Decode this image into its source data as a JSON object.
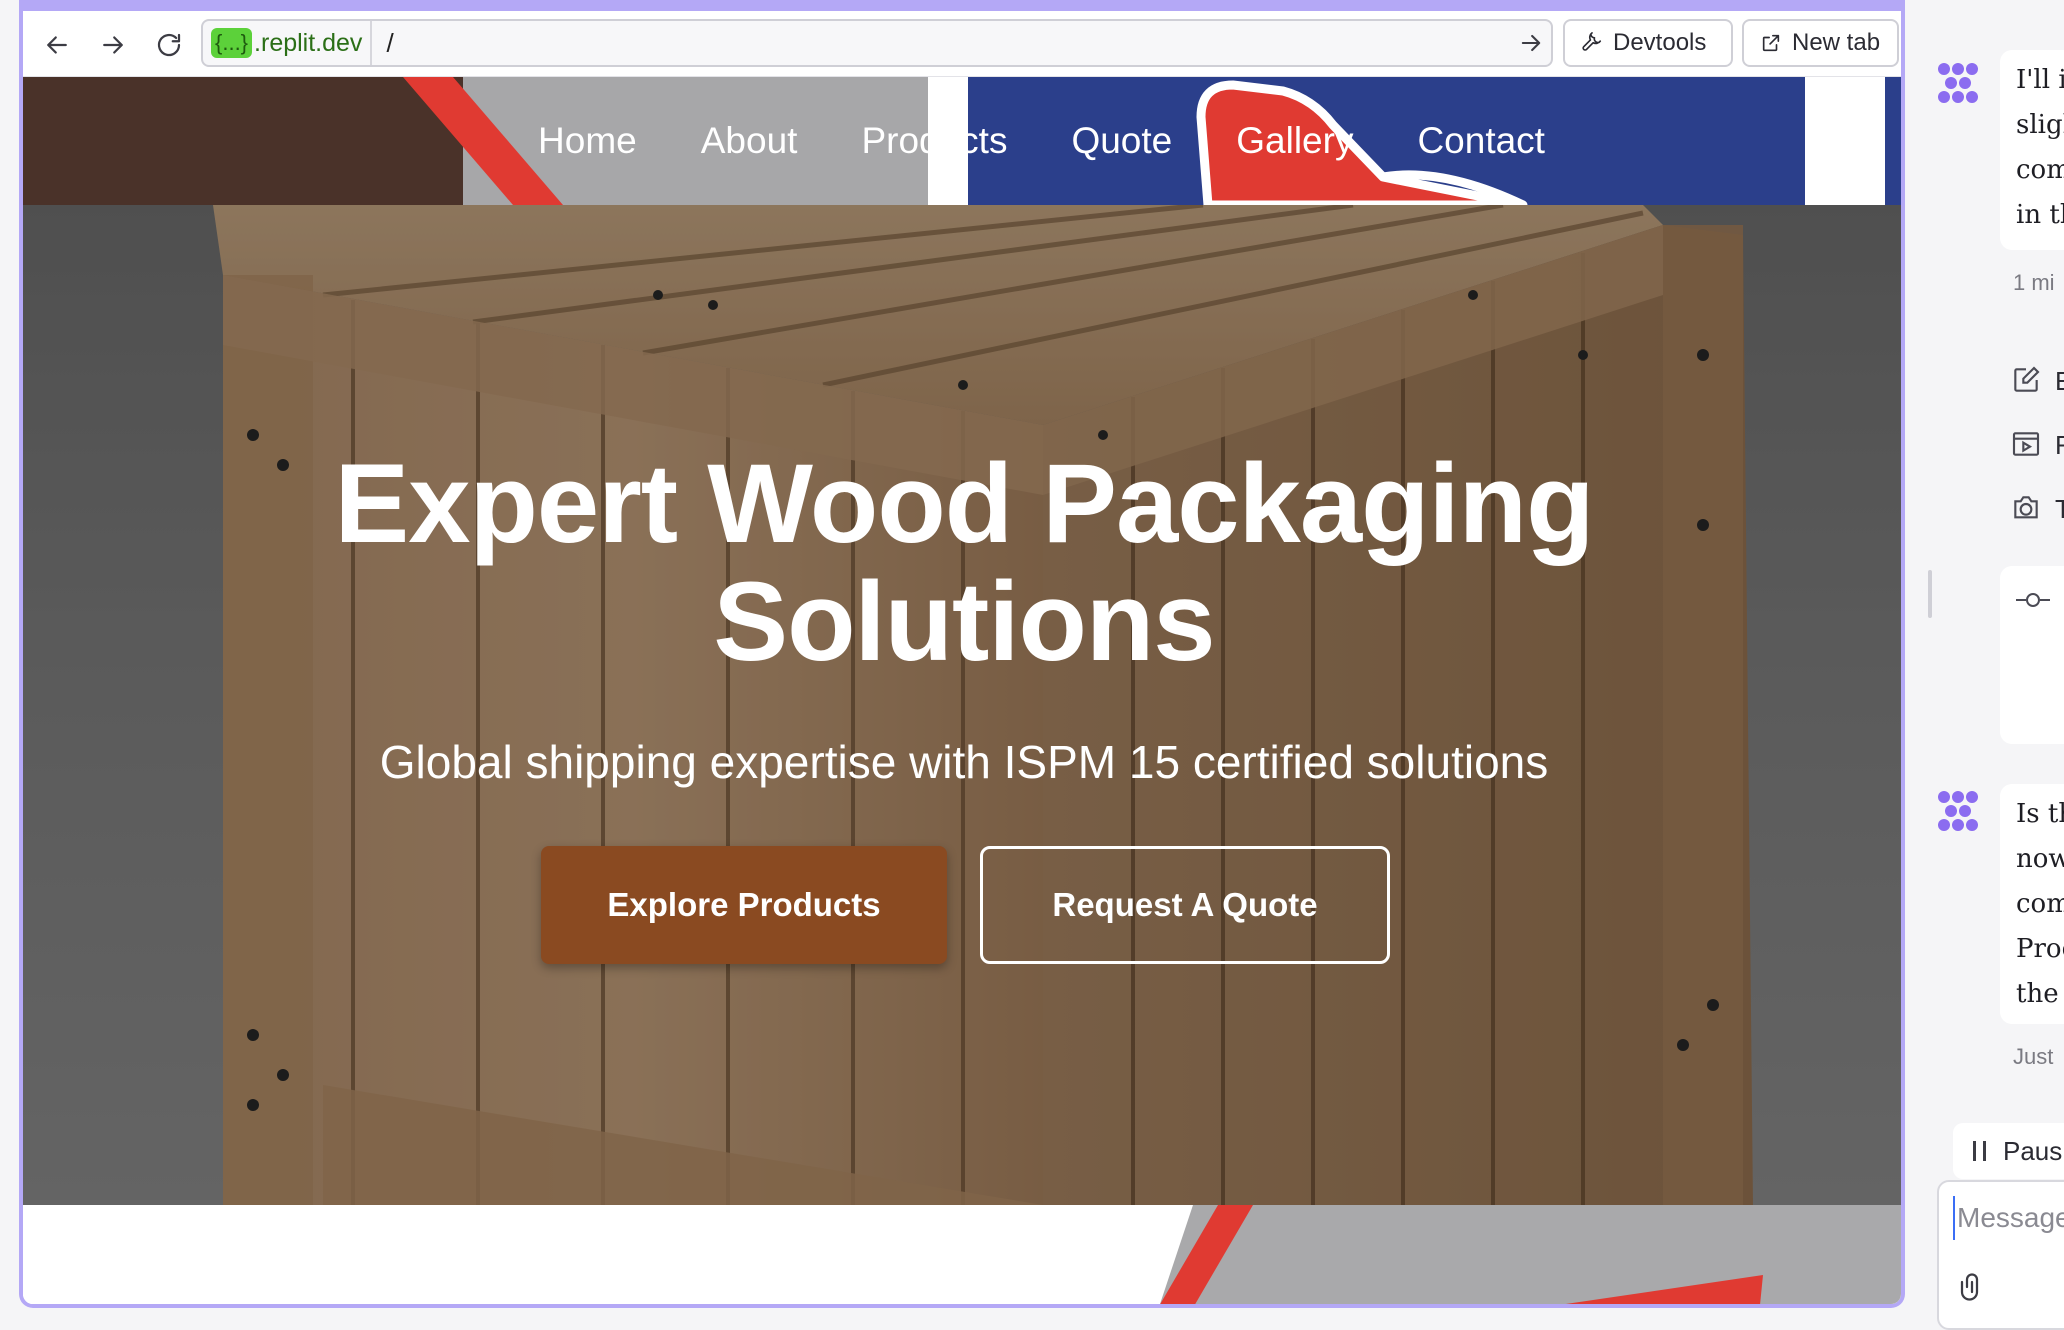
{
  "browser": {
    "back_icon": "arrow-left-icon",
    "forward_icon": "arrow-right-icon",
    "reload_icon": "reload-icon",
    "url_badge": "{...}",
    "url_host": ".replit.dev",
    "url_path": "/",
    "devtools_label": "Devtools",
    "newtab_label": "New tab"
  },
  "site": {
    "nav": [
      "Home",
      "About",
      "Products",
      "Quote",
      "Gallery",
      "Contact"
    ],
    "hero_title_line1": "Expert Wood Packaging",
    "hero_title_line2": "Solutions",
    "hero_subtitle": "Global shipping expertise with ISPM 15 certified solutions",
    "cta_primary": "Explore Products",
    "cta_secondary": "Request A Quote",
    "colors": {
      "nav_blue": "#2b3f8b",
      "brand_brown": "#8a4a21",
      "accent_red": "#e03a32"
    }
  },
  "chat": {
    "msg1_lines": [
      "I'll i",
      "sligh",
      "com",
      "in th"
    ],
    "msg1_time": "1 mi",
    "steps": [
      {
        "icon": "edit-icon",
        "label": "E"
      },
      {
        "icon": "play-icon",
        "label": "F"
      },
      {
        "icon": "camera-icon",
        "label": "T"
      }
    ],
    "commit_icon": "commit-icon",
    "msg2_lines": [
      "Is th",
      "now",
      "com",
      "Proc",
      "the r"
    ],
    "msg2_time": "Just",
    "pause_label": "Paus",
    "message_placeholder": "Message"
  }
}
